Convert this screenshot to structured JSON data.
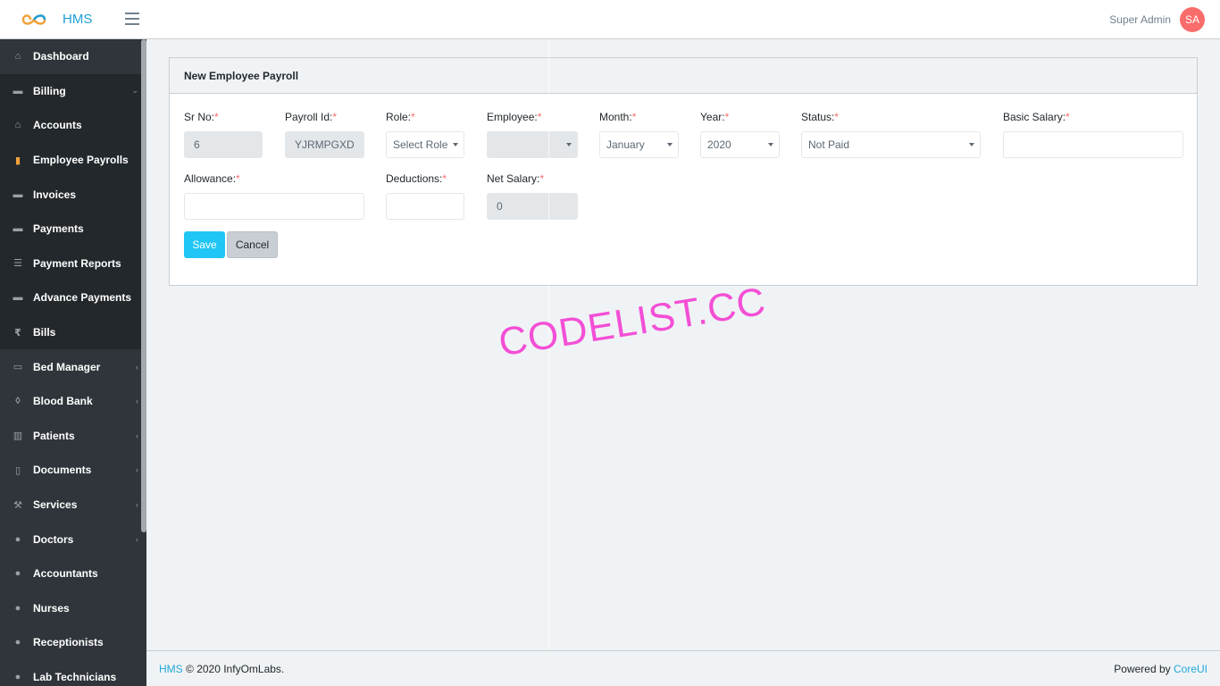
{
  "header": {
    "brand": "HMS",
    "user_name": "Super Admin",
    "avatar_initials": "SA"
  },
  "sidebar": {
    "items": [
      {
        "label": "Dashboard",
        "icon": "home-icon",
        "caret": ""
      },
      {
        "label": "Billing",
        "icon": "money-icon",
        "caret": "⌄"
      },
      {
        "label": "Accounts",
        "icon": "bank-icon",
        "caret": ""
      },
      {
        "label": "Employee Payrolls",
        "icon": "document-icon",
        "caret": ""
      },
      {
        "label": "Invoices",
        "icon": "invoice-icon",
        "caret": ""
      },
      {
        "label": "Payments",
        "icon": "money-icon",
        "caret": ""
      },
      {
        "label": "Payment Reports",
        "icon": "list-icon",
        "caret": ""
      },
      {
        "label": "Advance Payments",
        "icon": "money-icon",
        "caret": ""
      },
      {
        "label": "Bills",
        "icon": "rupee-icon",
        "caret": ""
      },
      {
        "label": "Bed Manager",
        "icon": "bed-icon",
        "caret": "‹"
      },
      {
        "label": "Blood Bank",
        "icon": "drop-icon",
        "caret": "‹"
      },
      {
        "label": "Patients",
        "icon": "patients-icon",
        "caret": "‹"
      },
      {
        "label": "Documents",
        "icon": "file-icon",
        "caret": "‹"
      },
      {
        "label": "Services",
        "icon": "wrench-icon",
        "caret": "‹"
      },
      {
        "label": "Doctors",
        "icon": "user-md-icon",
        "caret": "‹"
      },
      {
        "label": "Accountants",
        "icon": "users-icon",
        "caret": ""
      },
      {
        "label": "Nurses",
        "icon": "user-icon",
        "caret": ""
      },
      {
        "label": "Receptionists",
        "icon": "user-icon",
        "caret": ""
      },
      {
        "label": "Lab Technicians",
        "icon": "user-plus-icon",
        "caret": ""
      }
    ]
  },
  "form": {
    "title": "New Employee Payroll",
    "sr_no": {
      "label": "Sr No:",
      "value": "6"
    },
    "payroll_id": {
      "label": "Payroll Id:",
      "value": "YJRMPGXD"
    },
    "role": {
      "label": "Role:",
      "value": "Select Role"
    },
    "employee": {
      "label": "Employee:",
      "value": ""
    },
    "month": {
      "label": "Month:",
      "value": "January"
    },
    "year": {
      "label": "Year:",
      "value": "2020"
    },
    "status": {
      "label": "Status:",
      "value": "Not Paid"
    },
    "basic_salary": {
      "label": "Basic Salary:",
      "value": ""
    },
    "allowance": {
      "label": "Allowance:",
      "value": ""
    },
    "deductions": {
      "label": "Deductions:",
      "value": ""
    },
    "net_salary": {
      "label": "Net Salary:",
      "value": "0"
    },
    "required_mark": "*",
    "save_label": "Save",
    "cancel_label": "Cancel"
  },
  "watermark": "CODELIST.CC",
  "footer": {
    "brand_link": "HMS",
    "copyright": "© 2020 InfyOmLabs.",
    "powered_by": "Powered by",
    "powered_link": "CoreUI"
  },
  "colors": {
    "brand": "#1e9fd6",
    "sidebar_bg": "#2f353a",
    "primary_button": "#20c6f5",
    "required": "#f86c6b",
    "avatar": "#f86c6b",
    "watermark": "#f34fd6"
  }
}
